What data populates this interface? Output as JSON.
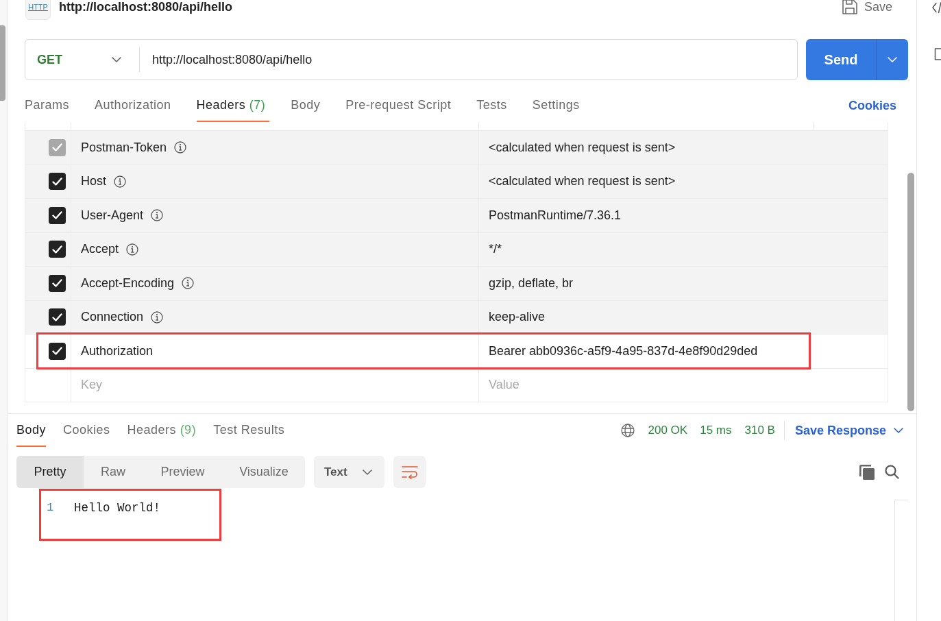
{
  "request": {
    "type_badge": "HTTP",
    "title": "http://localhost:8080/api/hello",
    "save_label": "Save",
    "method": "GET",
    "url": "http://localhost:8080/api/hello",
    "send_label": "Send"
  },
  "request_tabs": [
    {
      "label": "Params",
      "selected": false
    },
    {
      "label": "Authorization",
      "selected": false
    },
    {
      "label": "Headers",
      "count": "(7)",
      "selected": true
    },
    {
      "label": "Body",
      "selected": false
    },
    {
      "label": "Pre-request Script",
      "selected": false
    },
    {
      "label": "Tests",
      "selected": false
    },
    {
      "label": "Settings",
      "selected": false
    }
  ],
  "cookies_link": "Cookies",
  "headers": {
    "rows": [
      {
        "checked": true,
        "disabled": true,
        "key": "Postman-Token",
        "info_icon": true,
        "value": "<calculated when request is sent>",
        "auto_generated": true,
        "highlighted": false
      },
      {
        "checked": true,
        "disabled": false,
        "key": "Host",
        "info_icon": true,
        "value": "<calculated when request is sent>",
        "auto_generated": true,
        "highlighted": false
      },
      {
        "checked": true,
        "disabled": false,
        "key": "User-Agent",
        "info_icon": true,
        "value": "PostmanRuntime/7.36.1",
        "auto_generated": true,
        "highlighted": false
      },
      {
        "checked": true,
        "disabled": false,
        "key": "Accept",
        "info_icon": true,
        "value": "*/*",
        "auto_generated": true,
        "highlighted": false
      },
      {
        "checked": true,
        "disabled": false,
        "key": "Accept-Encoding",
        "info_icon": true,
        "value": "gzip, deflate, br",
        "auto_generated": true,
        "highlighted": false
      },
      {
        "checked": true,
        "disabled": false,
        "key": "Connection",
        "info_icon": true,
        "value": "keep-alive",
        "auto_generated": true,
        "highlighted": false
      },
      {
        "checked": true,
        "disabled": false,
        "key": "Authorization",
        "info_icon": false,
        "value": "Bearer abb0936c-a5f9-4a95-837d-4e8f90d29ded",
        "auto_generated": false,
        "highlighted": true
      }
    ],
    "key_placeholder": "Key",
    "value_placeholder": "Value"
  },
  "response": {
    "tabs": [
      {
        "label": "Body",
        "selected": true
      },
      {
        "label": "Cookies",
        "selected": false
      },
      {
        "label": "Headers",
        "count": "(9)",
        "selected": false
      },
      {
        "label": "Test Results",
        "selected": false
      }
    ],
    "status": "200 OK",
    "time": "15 ms",
    "size": "310 B",
    "save_label": "Save Response",
    "view_modes": [
      {
        "label": "Pretty",
        "selected": true
      },
      {
        "label": "Raw",
        "selected": false
      },
      {
        "label": "Preview",
        "selected": false
      },
      {
        "label": "Visualize",
        "selected": false
      }
    ],
    "format": "Text",
    "body": {
      "highlighted": true,
      "lines": [
        {
          "number": "1",
          "text": "Hello World!"
        }
      ]
    }
  }
}
